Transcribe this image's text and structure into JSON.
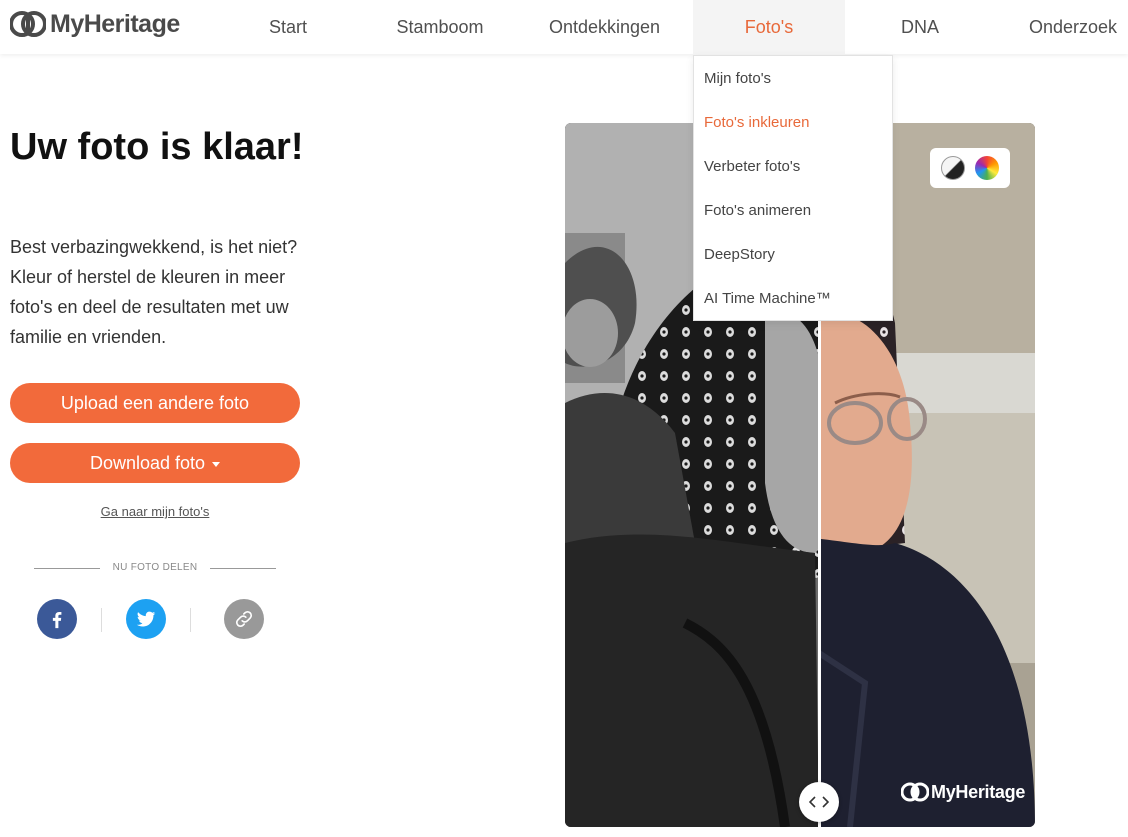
{
  "brand": {
    "name": "MyHeritage"
  },
  "nav": {
    "items": [
      {
        "label": "Start"
      },
      {
        "label": "Stamboom"
      },
      {
        "label": "Ontdekkingen"
      },
      {
        "label": "Foto's",
        "active": true
      },
      {
        "label": "DNA"
      },
      {
        "label": "Onderzoek"
      }
    ]
  },
  "dropdown": {
    "items": [
      {
        "label": "Mijn foto's"
      },
      {
        "label": "Foto's inkleuren",
        "active": true
      },
      {
        "label": "Verbeter foto's"
      },
      {
        "label": "Foto's animeren"
      },
      {
        "label": "DeepStory"
      },
      {
        "label": "AI Time Machine™"
      }
    ]
  },
  "main": {
    "title": "Uw foto is klaar!",
    "description": "Best verbazingwekkend, is het niet? Kleur of herstel de kleuren in meer foto's en deel de resultaten met uw familie en vrienden.",
    "upload_button": "Upload een andere foto",
    "download_button": "Download foto",
    "my_photos_link": "Ga naar mijn foto's",
    "share_label": "NU FOTO DELEN"
  },
  "share": {
    "facebook_icon": "facebook-icon",
    "twitter_icon": "twitter-icon",
    "link_icon": "link-icon"
  },
  "photo": {
    "watermark": "MyHeritage",
    "modes": [
      "original-bw",
      "colorized"
    ]
  },
  "colors": {
    "accent": "#f26a3b",
    "active_text": "#e8693a",
    "facebook": "#3b5998",
    "twitter": "#1da1f2",
    "link": "#999999"
  }
}
